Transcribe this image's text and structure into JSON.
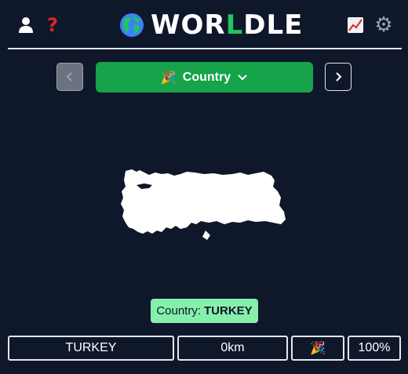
{
  "header": {
    "title_prefix": "WOR",
    "title_accent": "L",
    "title_suffix": "DLE",
    "icons": [
      "user-icon",
      "help-icon",
      "globe-icon",
      "stats-icon",
      "gear-icon"
    ],
    "help_glyph": "?",
    "gear_glyph": "⚙"
  },
  "nav": {
    "prev_glyph": "‹",
    "next_glyph": "›",
    "mode_label": "Country",
    "mode_emoji": "🎉",
    "mode_chevron": "⌄"
  },
  "answer": {
    "label": "Country:",
    "value": "TURKEY"
  },
  "guess": {
    "name": "TURKEY",
    "distance": "0km",
    "direction": "🎉",
    "proximity": "100%"
  },
  "colors": {
    "background": "#0f172a",
    "accent_green": "#16a34a",
    "title_green": "#22c55e",
    "answer_bg": "#86efac",
    "help_red": "#dc2626"
  }
}
